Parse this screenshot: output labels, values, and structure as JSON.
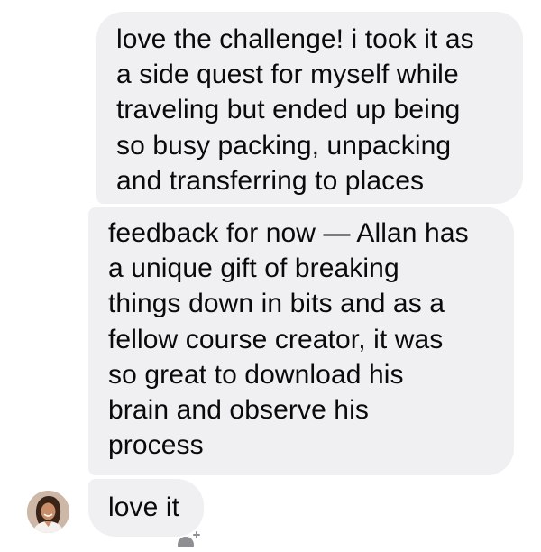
{
  "messages": [
    {
      "direction": "incoming",
      "text": "love the challenge! i took it as\na side quest for myself while\ntraveling but ended up being\nso busy packing, unpacking\nand transferring to places"
    },
    {
      "direction": "incoming",
      "text": "feedback for now — Allan has\na unique gift of breaking\nthings down in bits and as a\nfellow course creator, it was\nso great to download his\nbrain and observe his\nprocess"
    },
    {
      "direction": "incoming",
      "text": "love it"
    }
  ],
  "sender_avatar": {
    "icon": "avatar-photo"
  },
  "reaction_button": {
    "icon": "add-reaction-icon"
  },
  "colors": {
    "bubble_background": "#f0f0f3",
    "text": "#0a0a0a",
    "page_background": "#ffffff"
  }
}
